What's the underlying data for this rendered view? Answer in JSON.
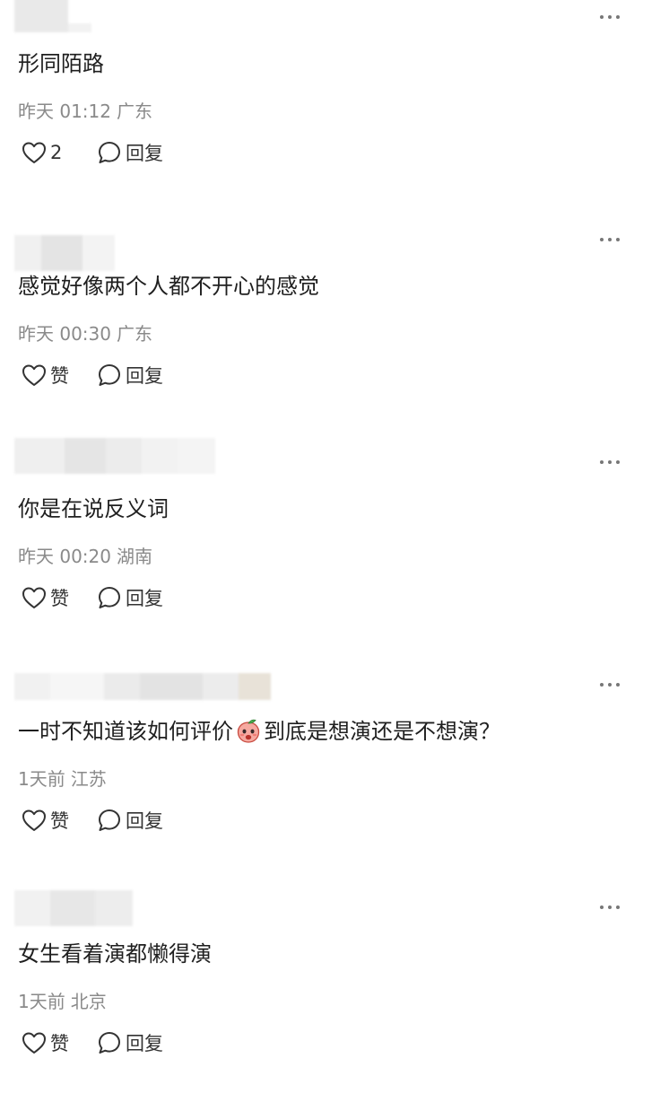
{
  "comments": [
    {
      "content": "形同陌路",
      "emoji": null,
      "content_after": "",
      "time": "昨天 01:12",
      "location": "广东",
      "like_label": "2",
      "reply_label": "回复"
    },
    {
      "content": "感觉好像两个人都不开心的感觉",
      "emoji": null,
      "content_after": "",
      "time": "昨天 00:30",
      "location": "广东",
      "like_label": "赞",
      "reply_label": "回复"
    },
    {
      "content": "你是在说反义词",
      "emoji": null,
      "content_after": "",
      "time": "昨天 00:20",
      "location": "湖南",
      "like_label": "赞",
      "reply_label": "回复"
    },
    {
      "content": "一时不知道该如何评价",
      "emoji": "peach-face-emoji",
      "content_after": "到底是想演还是不想演？",
      "time": "1天前",
      "location": "江苏",
      "like_label": "赞",
      "reply_label": "回复"
    },
    {
      "content": "女生看着演都懒得演",
      "emoji": null,
      "content_after": "",
      "time": "1天前",
      "location": "北京",
      "like_label": "赞",
      "reply_label": "回复"
    }
  ],
  "icons": {
    "like": "heart-outline-icon",
    "reply": "speech-bubble-icon",
    "more": "ellipsis-icon"
  },
  "colors": {
    "text": "#1f1f1f",
    "meta": "#8a8a8a",
    "icon": "#333333",
    "redacted": "#e6e6e6"
  }
}
